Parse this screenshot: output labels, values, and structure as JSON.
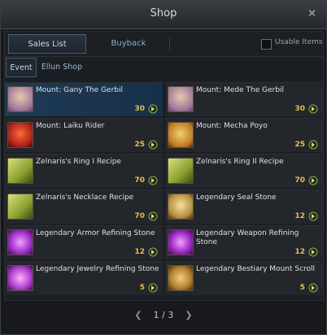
{
  "window": {
    "title": "Shop",
    "close_label": "×"
  },
  "tabs": [
    {
      "label": "Sales List"
    },
    {
      "label": "Buyback"
    }
  ],
  "usable_items_label": "Usable Items",
  "subtabs": [
    {
      "label": "Event"
    },
    {
      "label": "Ellun Shop"
    }
  ],
  "items": [
    {
      "name": "Mount: Gany The Gerbil",
      "price": "30",
      "icon": "gerbil-mount-icon"
    },
    {
      "name": "Mount: Mede The Gerbil",
      "price": "30",
      "icon": "gerbil-mount-icon"
    },
    {
      "name": "Mount: Laiku Rider",
      "price": "25",
      "icon": "laiku-rider-icon"
    },
    {
      "name": "Mount: Mecha Poyo",
      "price": "25",
      "icon": "mecha-poyo-icon"
    },
    {
      "name": "Zelnaris's Ring I Recipe",
      "price": "70",
      "icon": "recipe-scroll-icon"
    },
    {
      "name": "Zelnaris's Ring II Recipe",
      "price": "70",
      "icon": "recipe-scroll-icon"
    },
    {
      "name": "Zelnaris's Necklace Recipe",
      "price": "70",
      "icon": "recipe-scroll-icon"
    },
    {
      "name": "Legendary Seal Stone",
      "price": "12",
      "icon": "seal-stone-icon"
    },
    {
      "name": "Legendary Armor Refining Stone",
      "price": "12",
      "icon": "armor-refining-stone-icon"
    },
    {
      "name": "Legendary Weapon Refining Stone",
      "price": "12",
      "icon": "weapon-refining-stone-icon"
    },
    {
      "name": "Legendary Jewelry Refining Stone",
      "price": "5",
      "icon": "jewelry-refining-stone-icon"
    },
    {
      "name": "Legendary Bestiary Mount Scroll",
      "price": "5",
      "icon": "bestiary-scroll-icon"
    }
  ],
  "pager": {
    "current": "1",
    "separator": "/",
    "total": "3"
  },
  "colors": {
    "accent": "#7ab0d6",
    "price": "#e8c048",
    "selected": "#1f3a55"
  }
}
